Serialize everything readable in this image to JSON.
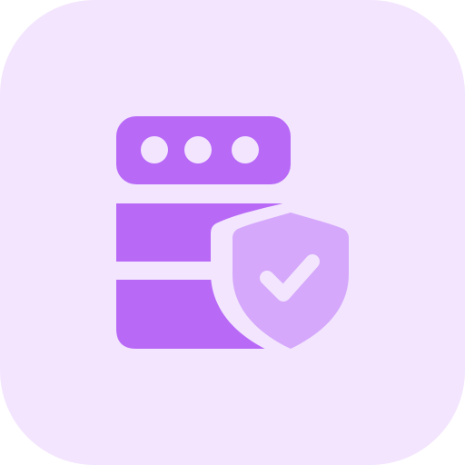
{
  "icon": {
    "name": "secure-server",
    "background_color": "#F3E5FE",
    "server_color": "#B86AF7",
    "shield_color": "#D5A8FB",
    "shield_outline_color": "#F3E5FE",
    "checkmark_color": "#F3E5FE",
    "indicator_color": "#F3E5FE"
  }
}
